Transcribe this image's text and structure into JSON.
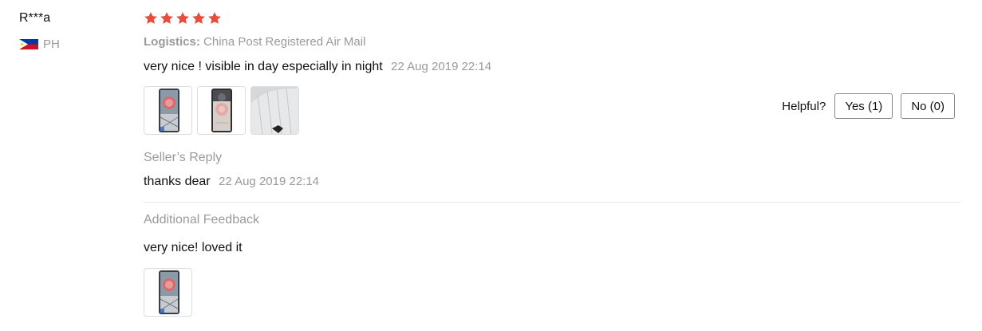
{
  "review": {
    "user_name": "R***a",
    "country_code": "PH",
    "rating": 5,
    "rating_color": "#e84c3d",
    "logistics_label": "Logistics:",
    "logistics_value": "China Post Registered Air Mail",
    "text": "very nice ! visible in day especially in night",
    "date": "22 Aug 2019 22:14",
    "photos": [
      "review-photo-1",
      "review-photo-2",
      "review-photo-3"
    ]
  },
  "helpful": {
    "label": "Helpful?",
    "yes_label": "Yes (1)",
    "no_label": "No (0)"
  },
  "seller_reply": {
    "title": "Seller’s Reply",
    "text": "thanks dear",
    "date": "22 Aug 2019 22:14"
  },
  "additional_feedback": {
    "title": "Additional Feedback",
    "text": "very nice! loved it",
    "photos": [
      "additional-photo-1"
    ]
  }
}
